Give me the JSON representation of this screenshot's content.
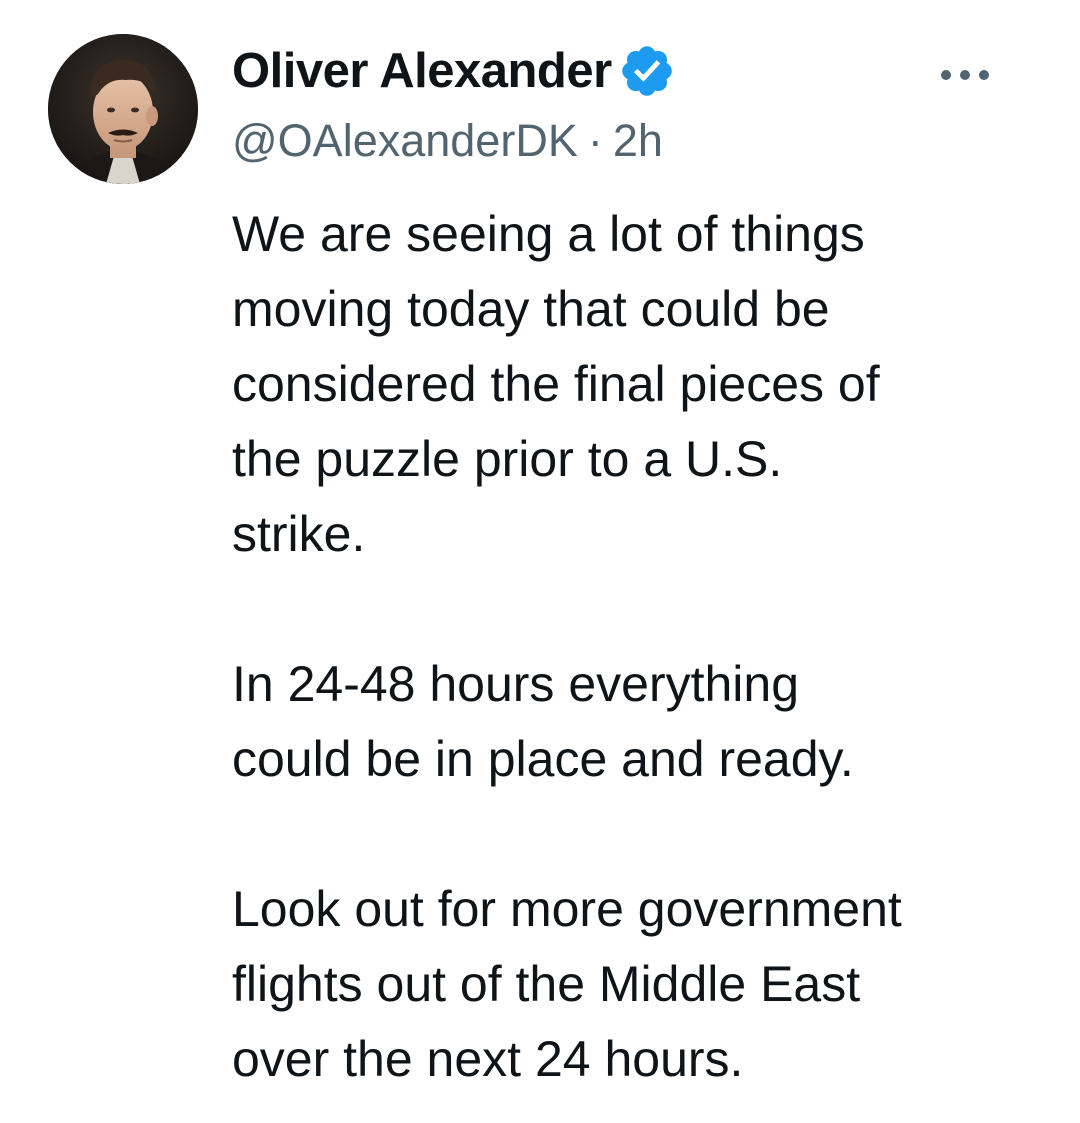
{
  "tweet": {
    "author": {
      "display_name": "Oliver Alexander",
      "handle": "@OAlexanderDK",
      "verified": true,
      "avatar_icon": "profile-photo"
    },
    "separator": "·",
    "timestamp": "2h",
    "more_icon": "more-horizontal-icon",
    "body": "We are seeing a lot of things\nmoving today that could be\nconsidered the final pieces of\nthe puzzle prior to a U.S.\nstrike.\n\nIn 24-48 hours everything\ncould be in place and ready.\n\nLook out for more government\nflights out of the Middle East\nover the next 24 hours."
  },
  "colors": {
    "text_primary": "#0f1419",
    "text_secondary": "#536471",
    "verified_blue": "#1d9bf0",
    "background": "#ffffff"
  }
}
